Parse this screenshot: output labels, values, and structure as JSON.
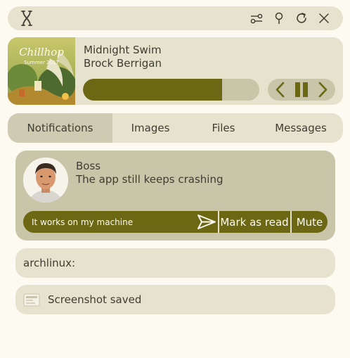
{
  "topbar": {
    "logo_icon": "bracket-x-logo-icon",
    "icons": [
      "sliders-icon",
      "pin-icon",
      "refresh-icon",
      "close-icon"
    ]
  },
  "player": {
    "album_art_text": "Chillhop Summer 2017",
    "title": "Midnight Swim",
    "artist": "Brock Berrigan",
    "progress": 0.79,
    "controls": [
      "prev-icon",
      "pause-icon",
      "next-icon"
    ]
  },
  "tabs": [
    {
      "label": "Notifications",
      "active": true
    },
    {
      "label": "Images",
      "active": false
    },
    {
      "label": "Files",
      "active": false
    },
    {
      "label": "Messages",
      "active": false
    }
  ],
  "notification": {
    "sender": "Boss",
    "body": "The app still keeps crashing",
    "reply_value": "It works on my machine",
    "mark_read_label": "Mark as read",
    "mute_label": "Mute"
  },
  "arch": {
    "text": "archlinux:"
  },
  "screenshot": {
    "text": "Screenshot saved"
  },
  "colors": {
    "background": "#fdfaf1",
    "surface": "#e6e2cd",
    "surface_dark": "#c9c5a8",
    "accent": "#6b6713",
    "text": "#3e3d32"
  }
}
